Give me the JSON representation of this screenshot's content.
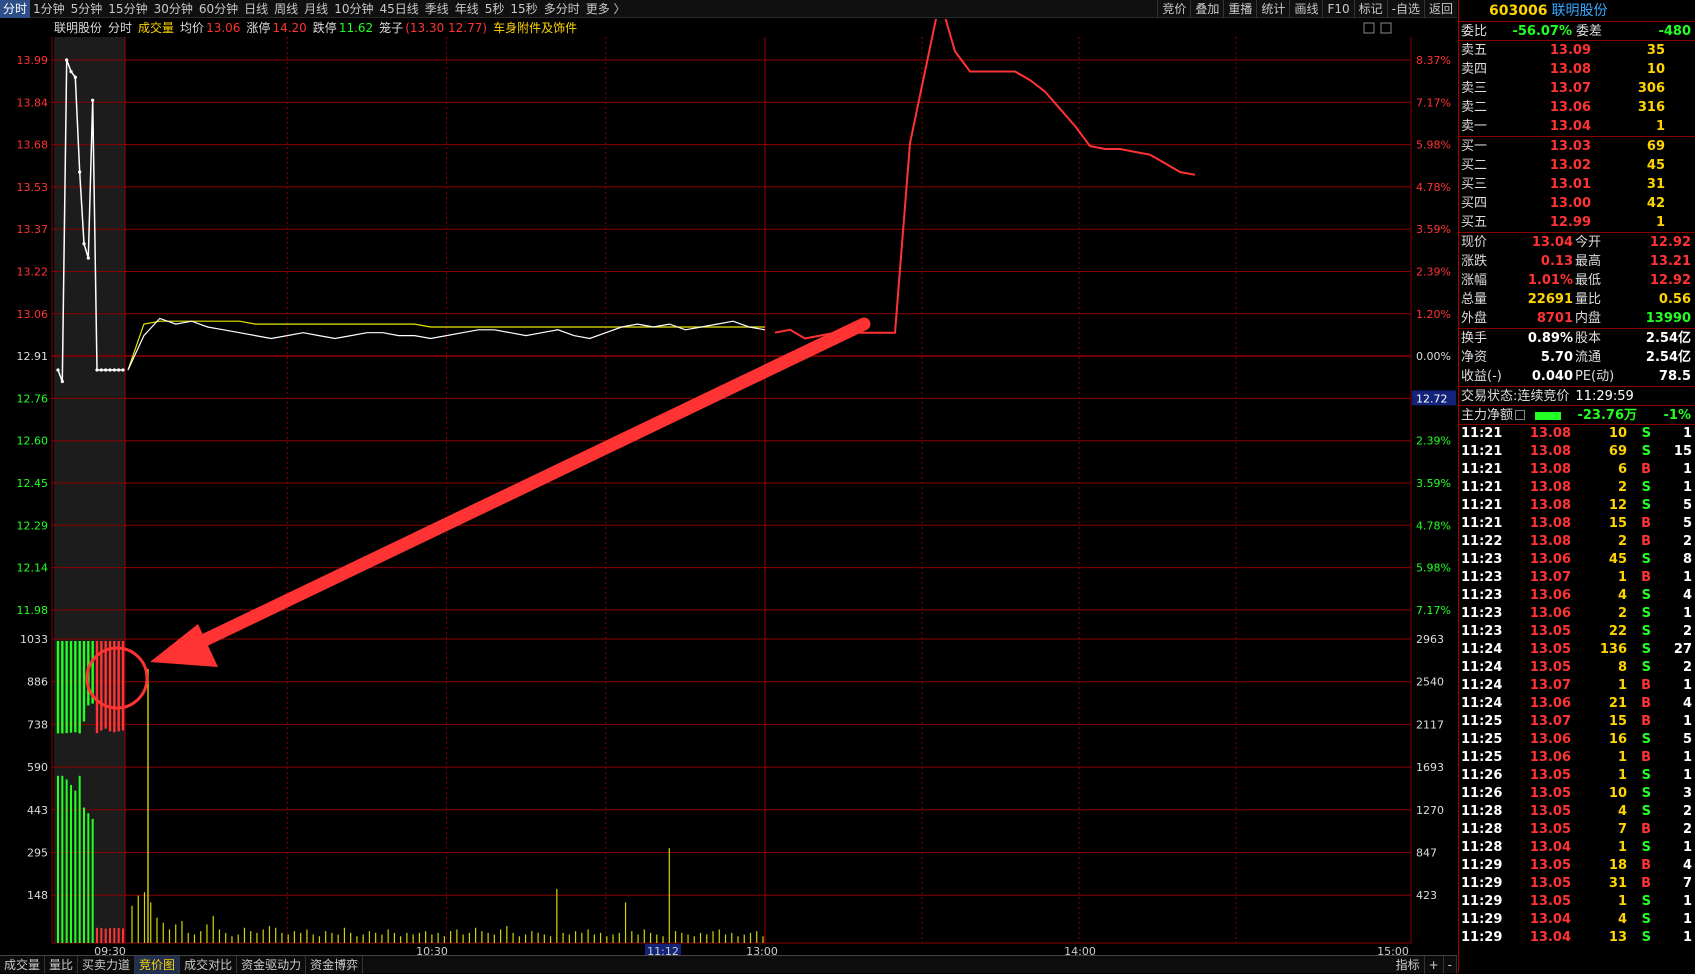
{
  "toolbar": {
    "periods": [
      "分时",
      "1分钟",
      "5分钟",
      "15分钟",
      "30分钟",
      "60分钟",
      "日线",
      "周线",
      "月线",
      "10分钟",
      "45日线",
      "季线",
      "年线",
      "5秒",
      "15秒",
      "多分时",
      "更多 〉"
    ],
    "active_index": 0,
    "right_buttons": [
      "竞价",
      "叠加",
      "重播",
      "统计",
      "画线",
      "F10",
      "标记",
      "-自选",
      "返回"
    ]
  },
  "chart_header": {
    "stock_name": "联明股份",
    "mode": "分时",
    "volume_label": "成交量",
    "avg_label": "均价",
    "avg_value": "13.06",
    "limit_up_label": "涨停",
    "limit_up_value": "14.20",
    "limit_down_label": "跌停",
    "limit_down_value": "11.62",
    "cage_label": "笼子",
    "cage_value": "(13.30 12.77)",
    "sector": "车身附件及饰件",
    "close_mark": "×"
  },
  "price_axis": {
    "left": [
      "13.99",
      "13.84",
      "13.68",
      "13.53",
      "13.37",
      "13.22",
      "13.06",
      "12.91",
      "12.76",
      "12.60",
      "12.45",
      "12.29",
      "12.14",
      "11.98"
    ],
    "right": [
      "8.37%",
      "7.17%",
      "5.98%",
      "4.78%",
      "3.59%",
      "2.39%",
      "1.20%",
      "0.00%",
      "2.39%",
      "3.59%",
      "4.78%",
      "5.98%",
      "7.17%"
    ],
    "right_pos": [
      0,
      1,
      2,
      3,
      4,
      5,
      6,
      7,
      9,
      10,
      11,
      12,
      13
    ],
    "price_tag": "12.72"
  },
  "volume_axis": {
    "left": [
      "1033",
      "886",
      "738",
      "590",
      "443",
      "295",
      "148"
    ],
    "right": [
      "2963",
      "2540",
      "2117",
      "1693",
      "1270",
      "847",
      "423"
    ]
  },
  "time_axis": [
    "09:30",
    "10:30",
    "11:12",
    "13:00",
    "14:00",
    "15:00"
  ],
  "chart_data": {
    "type": "line",
    "xlabel": "",
    "ylabel": "",
    "ylim": [
      11.98,
      13.99
    ],
    "auction": {
      "times": [
        "09:15",
        "09:16",
        "09:17",
        "09:18",
        "09:19",
        "09:20",
        "09:21",
        "09:22",
        "09:23",
        "09:24",
        "09:25",
        "09:26",
        "09:27",
        "09:28",
        "09:29",
        "09:30"
      ],
      "prices": [
        12.91,
        12.87,
        13.99,
        13.95,
        13.93,
        13.6,
        13.35,
        13.3,
        13.85,
        12.91,
        12.91,
        12.91,
        12.91,
        12.91,
        12.91,
        12.91
      ]
    },
    "series": [
      {
        "values": [
          12.91,
          13.03,
          13.09,
          13.07,
          13.08,
          13.06,
          13.05,
          13.04,
          13.03,
          13.02,
          13.03,
          13.04,
          13.03,
          13.02,
          13.03,
          13.04,
          13.04,
          13.03,
          13.03,
          13.02,
          13.03,
          13.04,
          13.05,
          13.05,
          13.04,
          13.03,
          13.04,
          13.05,
          13.03,
          13.02,
          13.04,
          13.06,
          13.07,
          13.06,
          13.07,
          13.05,
          13.06,
          13.07,
          13.08,
          13.06,
          13.05
        ]
      },
      {
        "values": [
          12.91,
          13.07,
          13.08,
          13.08,
          13.08,
          13.08,
          13.08,
          13.08,
          13.07,
          13.07,
          13.07,
          13.07,
          13.07,
          13.07,
          13.07,
          13.07,
          13.07,
          13.07,
          13.07,
          13.06,
          13.06,
          13.06,
          13.06,
          13.06,
          13.06,
          13.06,
          13.06,
          13.06,
          13.06,
          13.06,
          13.06,
          13.06,
          13.06,
          13.06,
          13.06,
          13.06,
          13.06,
          13.06,
          13.06,
          13.06,
          13.06
        ]
      },
      {
        "values": [
          13.04,
          13.05,
          13.02,
          13.03,
          13.04,
          13.04,
          13.04,
          13.04,
          13.04,
          13.7,
          13.95,
          14.2,
          14.02,
          13.95,
          13.95,
          13.95,
          13.95,
          13.92,
          13.88,
          13.82,
          13.76,
          13.69,
          13.68,
          13.68,
          13.67,
          13.66,
          13.63,
          13.6,
          13.59
        ]
      }
    ],
    "auction_volume": [
      1033,
      1033,
      1030,
      1025,
      1020,
      1033,
      900,
      720,
      700,
      1030,
      1000,
      980,
      1010,
      1020,
      1010,
      1000
    ],
    "auction_ratio": [
      2963,
      2963,
      2900,
      2800,
      2700,
      2963,
      2400,
      2300,
      2200,
      2963,
      2900,
      2800,
      2900,
      2950,
      2900,
      2850
    ],
    "volume": [
      110,
      140,
      150,
      120,
      75,
      60,
      40,
      55,
      65,
      30,
      25,
      35,
      55,
      80,
      40,
      30,
      20,
      25,
      45,
      35,
      30,
      40,
      50,
      45,
      30,
      25,
      35,
      30,
      40,
      25,
      20,
      35,
      30,
      25,
      45,
      30,
      20,
      25,
      35,
      30,
      25,
      40,
      30,
      20,
      30,
      25,
      30,
      35,
      25,
      30,
      20,
      35,
      40,
      25,
      30,
      45,
      35,
      30,
      25,
      40,
      50,
      30,
      20,
      25,
      35,
      30,
      25,
      20,
      160,
      30,
      25,
      35,
      30,
      40,
      25,
      30,
      20,
      25,
      30,
      120,
      35,
      25,
      40,
      30,
      25,
      20,
      280,
      35,
      30,
      25,
      20,
      30,
      25,
      35,
      40,
      25,
      30,
      20,
      25,
      30,
      35,
      20
    ]
  },
  "panel": {
    "code": "603006",
    "name": "联明股份",
    "weibi_label": "委比",
    "weibi_value": "-56.07%",
    "weicha_label": "委差",
    "weicha_value": "-480",
    "asks": [
      {
        "label": "卖五",
        "price": "13.09",
        "vol": "35"
      },
      {
        "label": "卖四",
        "price": "13.08",
        "vol": "10"
      },
      {
        "label": "卖三",
        "price": "13.07",
        "vol": "306"
      },
      {
        "label": "卖二",
        "price": "13.06",
        "vol": "316"
      },
      {
        "label": "卖一",
        "price": "13.04",
        "vol": "1"
      }
    ],
    "bids": [
      {
        "label": "买一",
        "price": "13.03",
        "vol": "69"
      },
      {
        "label": "买二",
        "price": "13.02",
        "vol": "45"
      },
      {
        "label": "买三",
        "price": "13.01",
        "vol": "31"
      },
      {
        "label": "买四",
        "price": "13.00",
        "vol": "42"
      },
      {
        "label": "买五",
        "price": "12.99",
        "vol": "1"
      }
    ],
    "stats": [
      {
        "l1": "现价",
        "v1": "13.04",
        "c1": "red",
        "l2": "今开",
        "v2": "12.92",
        "c2": "red"
      },
      {
        "l1": "涨跌",
        "v1": "0.13",
        "c1": "red",
        "l2": "最高",
        "v2": "13.21",
        "c2": "red"
      },
      {
        "l1": "涨幅",
        "v1": "1.01%",
        "c1": "red",
        "l2": "最低",
        "v2": "12.92",
        "c2": "red"
      },
      {
        "l1": "总量",
        "v1": "22691",
        "c1": "yel",
        "l2": "量比",
        "v2": "0.56",
        "c2": "yel"
      },
      {
        "l1": "外盘",
        "v1": "8701",
        "c1": "red",
        "l2": "内盘",
        "v2": "13990",
        "c2": "grn"
      }
    ],
    "stats2": [
      {
        "l1": "换手",
        "v1": "0.89%",
        "c1": "wht",
        "l2": "股本",
        "v2": "2.54亿",
        "c2": "wht"
      },
      {
        "l1": "净资",
        "v1": "5.70",
        "c1": "wht",
        "l2": "流通",
        "v2": "2.54亿",
        "c2": "wht"
      },
      {
        "l1": "收益(-)",
        "v1": "0.040",
        "c1": "wht",
        "l2": "PE(动)",
        "v2": "78.5",
        "c2": "wht"
      }
    ],
    "trade_status_label": "交易状态:",
    "trade_status": "连续竞价",
    "trade_time": "11:29:59",
    "mainflow_label": "主力净额",
    "mainflow_value": "-23.76万",
    "mainflow_pct": "-1%",
    "ticks": [
      {
        "t": "11:21",
        "p": "13.08",
        "v": "10",
        "s": "S",
        "n": "1"
      },
      {
        "t": "11:21",
        "p": "13.08",
        "v": "69",
        "s": "S",
        "n": "15"
      },
      {
        "t": "11:21",
        "p": "13.08",
        "v": "6",
        "s": "B",
        "n": "1"
      },
      {
        "t": "11:21",
        "p": "13.08",
        "v": "2",
        "s": "S",
        "n": "1"
      },
      {
        "t": "11:21",
        "p": "13.08",
        "v": "12",
        "s": "S",
        "n": "5"
      },
      {
        "t": "11:21",
        "p": "13.08",
        "v": "15",
        "s": "B",
        "n": "5"
      },
      {
        "t": "11:22",
        "p": "13.08",
        "v": "2",
        "s": "B",
        "n": "2"
      },
      {
        "t": "11:23",
        "p": "13.06",
        "v": "45",
        "s": "S",
        "n": "8"
      },
      {
        "t": "11:23",
        "p": "13.07",
        "v": "1",
        "s": "B",
        "n": "1"
      },
      {
        "t": "11:23",
        "p": "13.06",
        "v": "4",
        "s": "S",
        "n": "4"
      },
      {
        "t": "11:23",
        "p": "13.06",
        "v": "2",
        "s": "S",
        "n": "1"
      },
      {
        "t": "11:23",
        "p": "13.05",
        "v": "22",
        "s": "S",
        "n": "2"
      },
      {
        "t": "11:24",
        "p": "13.05",
        "v": "136",
        "s": "S",
        "n": "27"
      },
      {
        "t": "11:24",
        "p": "13.05",
        "v": "8",
        "s": "S",
        "n": "2"
      },
      {
        "t": "11:24",
        "p": "13.07",
        "v": "1",
        "s": "B",
        "n": "1"
      },
      {
        "t": "11:24",
        "p": "13.06",
        "v": "21",
        "s": "B",
        "n": "4"
      },
      {
        "t": "11:25",
        "p": "13.07",
        "v": "15",
        "s": "B",
        "n": "1"
      },
      {
        "t": "11:25",
        "p": "13.06",
        "v": "16",
        "s": "S",
        "n": "5"
      },
      {
        "t": "11:25",
        "p": "13.06",
        "v": "1",
        "s": "B",
        "n": "1"
      },
      {
        "t": "11:26",
        "p": "13.05",
        "v": "1",
        "s": "S",
        "n": "1"
      },
      {
        "t": "11:26",
        "p": "13.05",
        "v": "10",
        "s": "S",
        "n": "3"
      },
      {
        "t": "11:28",
        "p": "13.05",
        "v": "4",
        "s": "S",
        "n": "2"
      },
      {
        "t": "11:28",
        "p": "13.05",
        "v": "7",
        "s": "B",
        "n": "2"
      },
      {
        "t": "11:28",
        "p": "13.04",
        "v": "1",
        "s": "S",
        "n": "1"
      },
      {
        "t": "11:29",
        "p": "13.05",
        "v": "18",
        "s": "B",
        "n": "4"
      },
      {
        "t": "11:29",
        "p": "13.05",
        "v": "31",
        "s": "B",
        "n": "7"
      },
      {
        "t": "11:29",
        "p": "13.05",
        "v": "1",
        "s": "S",
        "n": "1"
      },
      {
        "t": "11:29",
        "p": "13.04",
        "v": "4",
        "s": "S",
        "n": "1"
      },
      {
        "t": "11:29",
        "p": "13.04",
        "v": "13",
        "s": "S",
        "n": "1"
      }
    ]
  },
  "bottom_tabs": [
    "成交量",
    "量比",
    "买卖力道",
    "竞价图",
    "成交对比",
    "资金驱动力",
    "资金博弈"
  ],
  "bottom_active": 3,
  "bottom_right": [
    "指标",
    "+",
    "-"
  ],
  "colors": {
    "up": "#ff3333",
    "down": "#22ff22",
    "grid": "#8a0000",
    "avg": "#e6e600",
    "price": "#ffffff"
  }
}
